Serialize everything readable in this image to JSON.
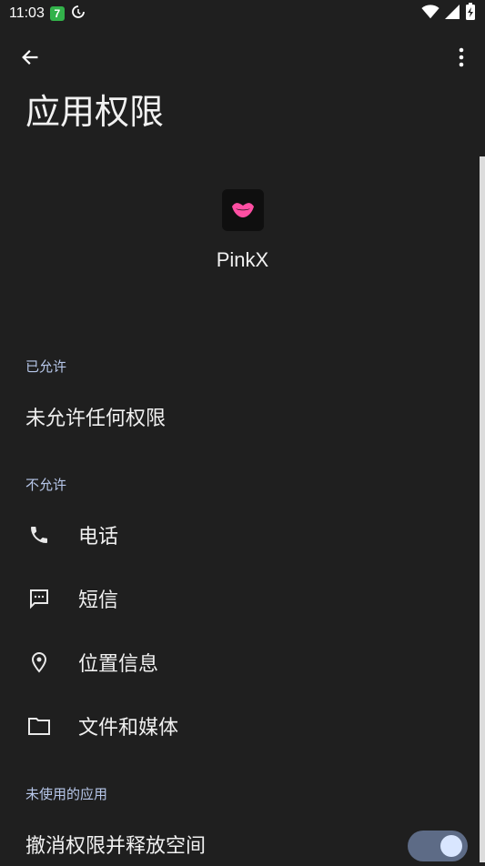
{
  "status_bar": {
    "time": "11:03",
    "badge_text": "7",
    "icons": [
      "sync-icon",
      "wifi-icon",
      "signal-icon",
      "battery-charging-icon"
    ]
  },
  "toolbar": {
    "back_icon": "arrow-back-icon",
    "more_icon": "more-vert-icon"
  },
  "page": {
    "title": "应用权限"
  },
  "app": {
    "name": "PinkX",
    "icon": "pink-lips-icon",
    "icon_color": "#ff4fa3"
  },
  "sections": {
    "allowed": {
      "header": "已允许",
      "empty_text": "未允许任何权限"
    },
    "not_allowed": {
      "header": "不允许",
      "items": [
        {
          "label": "电话",
          "icon": "phone-icon"
        },
        {
          "label": "短信",
          "icon": "sms-icon"
        },
        {
          "label": "位置信息",
          "icon": "location-icon"
        },
        {
          "label": "文件和媒体",
          "icon": "folder-icon"
        }
      ]
    },
    "unused_apps": {
      "header": "未使用的应用",
      "toggle_label": "撤消权限并释放空间",
      "toggle_on": true
    }
  },
  "colors": {
    "background": "#1f1f1f",
    "section_header": "#b7c7ea",
    "toggle_track": "#5d6b86",
    "toggle_knob": "#d9e6ff"
  }
}
